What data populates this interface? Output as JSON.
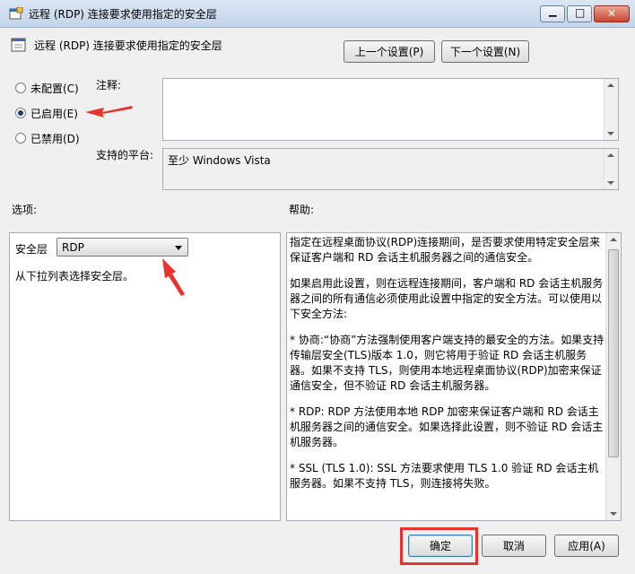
{
  "window": {
    "title": "远程 (RDP) 连接要求使用指定的安全层",
    "minimize_glyph": "▁",
    "maximize_glyph": "□",
    "close_glyph": "✕"
  },
  "header": {
    "policy_title": "远程 (RDP) 连接要求使用指定的安全层",
    "prev_button": "上一个设置(P)",
    "next_button": "下一个设置(N)"
  },
  "state": {
    "not_configured": "未配置(C)",
    "enabled": "已启用(E)",
    "disabled": "已禁用(D)",
    "selected": "enabled"
  },
  "comment": {
    "label": "注释:",
    "value": ""
  },
  "platform": {
    "label": "支持的平台:",
    "value": "至少 Windows Vista"
  },
  "options": {
    "label": "选项:",
    "security_layer_label": "安全层",
    "security_layer_value": "RDP",
    "hint": "从下拉列表选择安全层。"
  },
  "help": {
    "label": "帮助:",
    "paragraphs": [
      "指定在远程桌面协议(RDP)连接期间，是否要求使用特定安全层来保证客户端和 RD 会话主机服务器之间的通信安全。",
      "如果启用此设置，则在远程连接期间，客户端和 RD 会话主机服务器之间的所有通信必须使用此设置中指定的安全方法。可以使用以下安全方法:",
      "* 协商:“协商”方法强制使用客户端支持的最安全的方法。如果支持传输层安全(TLS)版本 1.0，则它将用于验证 RD 会话主机服务器。如果不支持 TLS，则使用本地远程桌面协议(RDP)加密来保证通信安全，但不验证 RD 会话主机服务器。",
      "* RDP: RDP 方法使用本地 RDP 加密来保证客户端和 RD 会话主机服务器之间的通信安全。如果选择此设置，则不验证 RD 会话主机服务器。",
      "* SSL (TLS 1.0): SSL 方法要求使用 TLS 1.0 验证 RD 会话主机服务器。如果不支持 TLS，则连接将失败。"
    ]
  },
  "footer": {
    "ok": "确定",
    "cancel": "取消",
    "apply": "应用(A)"
  },
  "colors": {
    "annotation_red": "#e8322b",
    "radio_dot": "#1f3c70"
  }
}
